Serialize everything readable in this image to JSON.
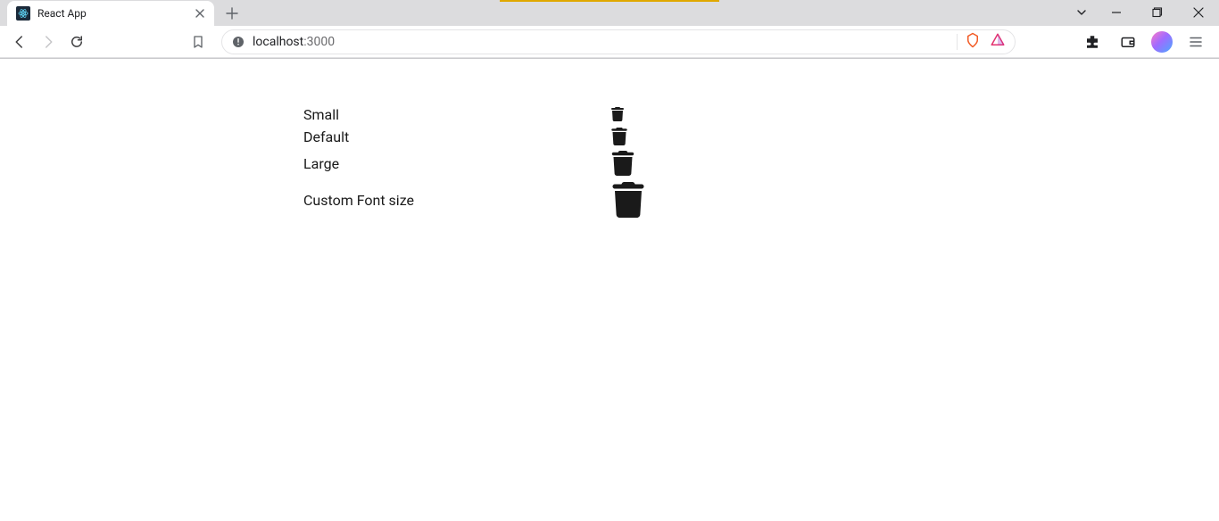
{
  "browser": {
    "tab_title": "React App",
    "url_host": "localhost",
    "url_port": ":3000"
  },
  "rows": [
    {
      "label": "Small",
      "size": "small"
    },
    {
      "label": "Default",
      "size": "default"
    },
    {
      "label": "Large",
      "size": "large"
    },
    {
      "label": "Custom Font size",
      "size": "custom"
    }
  ]
}
